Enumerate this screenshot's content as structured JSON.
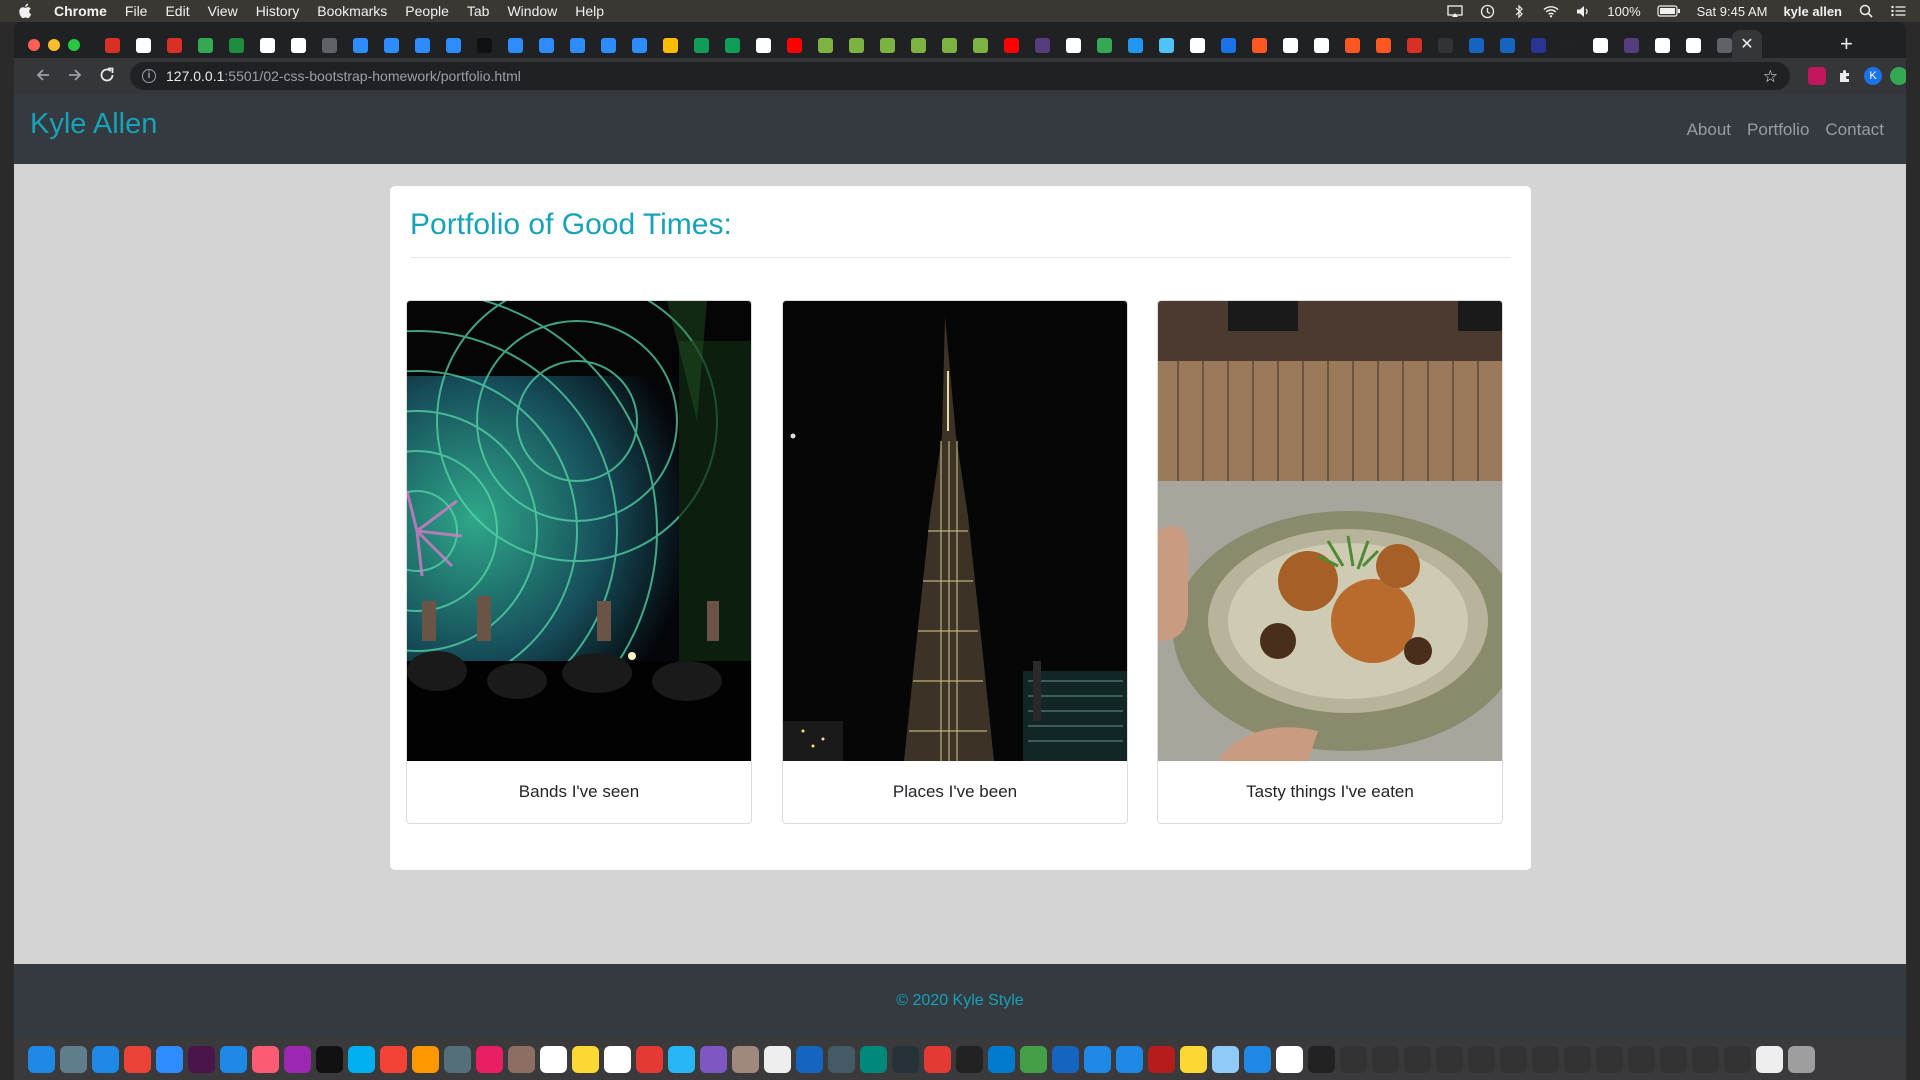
{
  "os_menubar": {
    "app_name": "Chrome",
    "menus": [
      "File",
      "Edit",
      "View",
      "History",
      "Bookmarks",
      "People",
      "Tab",
      "Window",
      "Help"
    ],
    "battery": "100%",
    "clock": "Sat 9:45 AM",
    "user": "kyle allen"
  },
  "browser": {
    "tab_close_glyph": "✕",
    "new_tab_glyph": "+",
    "url_host": "127.0.0.1",
    "url_rest": ":5501/02-css-bootstrap-homework/portfolio.html",
    "profile_initial": "K",
    "favicon_colors": [
      "#d93025",
      "#ffffff",
      "#d93025",
      "#34a853",
      "#1e8e3e",
      "#ffffff",
      "#ffffff",
      "#5f6368",
      "#2d8cff",
      "#2d8cff",
      "#2d8cff",
      "#2d8cff",
      "#111111",
      "#2d8cff",
      "#2d8cff",
      "#2d8cff",
      "#2d8cff",
      "#2d8cff",
      "#fbbc04",
      "#0f9d58",
      "#0f9d58",
      "#ffffff",
      "#ff0000",
      "#7cb342",
      "#7cb342",
      "#7cb342",
      "#7cb342",
      "#7cb342",
      "#7cb342",
      "#ff0000",
      "#563d7c",
      "#ffffff",
      "#34a853",
      "#2196f3",
      "#4fc3f7",
      "#ffffff",
      "#1a73e8",
      "#ff5722",
      "#ffffff",
      "#ffffff",
      "#ff5722",
      "#ff5722",
      "#d93025",
      "#333333",
      "#1565c0",
      "#1565c0",
      "#283593",
      "#222222",
      "#ffffff",
      "#563d7c",
      "#ffffff",
      "#ffffff",
      "#5f6368"
    ]
  },
  "site": {
    "brand": "Kyle Allen",
    "nav": [
      "About",
      "Portfolio",
      "Contact"
    ],
    "heading": "Portfolio of Good Times:",
    "cards": [
      {
        "caption": "Bands I've seen",
        "image": "concert-stage-image"
      },
      {
        "caption": "Places I've been",
        "image": "burj-khalifa-night-image"
      },
      {
        "caption": "Tasty things I've eaten",
        "image": "food-bowl-image"
      }
    ],
    "footer": "© 2020 Kyle Style"
  },
  "colors": {
    "accent": "#17a2b8",
    "nav_bg": "#343a40",
    "page_bg": "#d4d4d4"
  },
  "dock_colors": [
    "#1e88e5",
    "#607d8b",
    "#1e88e5",
    "#ea4335",
    "#2d8cff",
    "#4a154b",
    "#1e88e5",
    "#fb5c74",
    "#9c27b0",
    "#111111",
    "#00aff0",
    "#f44336",
    "#ff9800",
    "#546e7a",
    "#e91e63",
    "#8d6e63",
    "#ffffff",
    "#fdd835",
    "#ffffff",
    "#e53935",
    "#29b6f6",
    "#7e57c2",
    "#a1887f",
    "#eeeeee",
    "#1565c0",
    "#455a64",
    "#00897b",
    "#263238",
    "#e53935",
    "#222222",
    "#007acc",
    "#43a047",
    "#1565c0",
    "#1e88e5",
    "#1e88e5",
    "#b71c1c",
    "#fdd835",
    "#90caf9",
    "#1e88e5",
    "#ffffff",
    "#222222",
    "#333333",
    "#333333",
    "#333333",
    "#333333",
    "#333333",
    "#333333",
    "#333333",
    "#333333",
    "#333333",
    "#333333",
    "#333333",
    "#333333",
    "#333333",
    "#eeeeee",
    "#9e9e9e"
  ]
}
